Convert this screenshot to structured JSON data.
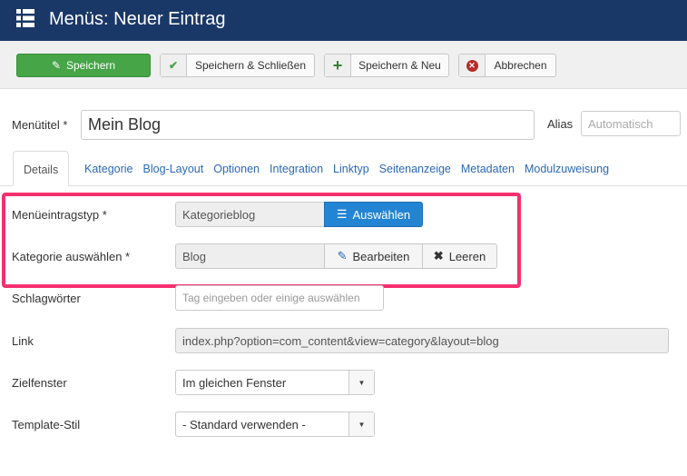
{
  "header": {
    "title": "Menüs: Neuer Eintrag",
    "icon": "list-icon"
  },
  "toolbar": {
    "save": "Speichern",
    "save_close": "Speichern & Schließen",
    "save_new": "Speichern & Neu",
    "cancel": "Abbrechen"
  },
  "title_field": {
    "label": "Menütitel *",
    "value": "Mein Blog"
  },
  "alias_field": {
    "label": "Alias",
    "placeholder": "Automatisch"
  },
  "tabs": [
    "Details",
    "Kategorie",
    "Blog-Layout",
    "Optionen",
    "Integration",
    "Linktyp",
    "Seitenanzeige",
    "Metadaten",
    "Modulzuweisung"
  ],
  "form": {
    "type": {
      "label": "Menüeintragstyp *",
      "value": "Kategorieblog",
      "button": "Auswählen"
    },
    "category": {
      "label": "Kategorie auswählen *",
      "value": "Blog",
      "edit": "Bearbeiten",
      "clear": "Leeren"
    },
    "tags": {
      "label": "Schlagwörter",
      "placeholder": "Tag eingeben oder einige auswählen"
    },
    "link": {
      "label": "Link",
      "value": "index.php?option=com_content&view=category&layout=blog"
    },
    "target": {
      "label": "Zielfenster",
      "value": "Im gleichen Fenster"
    },
    "template": {
      "label": "Template-Stil",
      "value": "- Standard verwenden -"
    }
  },
  "colors": {
    "header": "#1a3867",
    "save": "#46a546",
    "select_button": "#2384d3",
    "highlight": "#f5306f",
    "tab_link": "#2a69b8"
  }
}
